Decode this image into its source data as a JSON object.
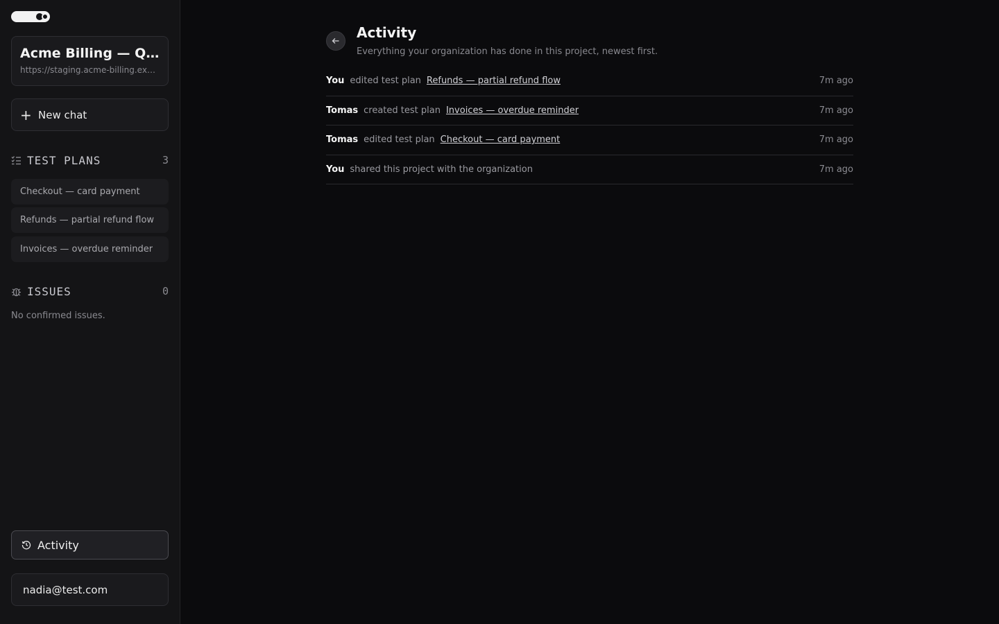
{
  "sidebar": {
    "project": {
      "title": "Acme Billing — QA regression",
      "url": "https://staging.acme-billing.example.com"
    },
    "new_chat_label": "New chat",
    "test_plans": {
      "title": "TEST PLANS",
      "count": "3",
      "items": [
        {
          "label": "Checkout — card payment"
        },
        {
          "label": "Refunds — partial refund flow"
        },
        {
          "label": "Invoices — overdue reminder"
        }
      ]
    },
    "issues": {
      "title": "ISSUES",
      "count": "0",
      "empty_text": "No confirmed issues."
    },
    "activity_label": "Activity",
    "user_email": "nadia@test.com"
  },
  "main": {
    "title": "Activity",
    "subtitle": "Everything your organization has done in this project, newest first.",
    "events": [
      {
        "actor": "You",
        "action": "edited test plan",
        "target": "Refunds — partial refund flow",
        "time": "7m ago"
      },
      {
        "actor": "Tomas",
        "action": "created test plan",
        "target": "Invoices — overdue reminder",
        "time": "7m ago"
      },
      {
        "actor": "Tomas",
        "action": "edited test plan",
        "target": "Checkout — card payment",
        "time": "7m ago"
      },
      {
        "actor": "You",
        "action": "shared this project with the organization",
        "target": "",
        "time": "7m ago"
      }
    ]
  }
}
